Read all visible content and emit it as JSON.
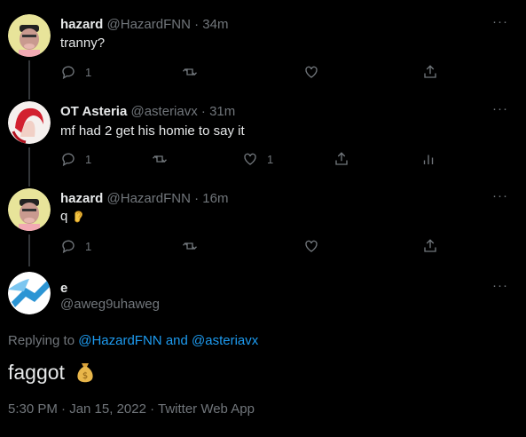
{
  "replies": [
    {
      "name": "hazard",
      "handle": "@HazardFNN",
      "time": "· 34m",
      "text": "tranny?",
      "actions": {
        "reply_count": "1",
        "retweet_count": "",
        "like_count": ""
      }
    },
    {
      "name": "OT Asteria",
      "handle": "@asteriavx",
      "time": "· 31m",
      "text": "mf had 2 get his homie to say it",
      "actions": {
        "reply_count": "1",
        "retweet_count": "",
        "like_count": "1"
      }
    },
    {
      "name": "hazard",
      "handle": "@HazardFNN",
      "time": "· 16m",
      "text": "q",
      "actions": {
        "reply_count": "1",
        "retweet_count": "",
        "like_count": ""
      }
    }
  ],
  "main_tweet": {
    "name": "e",
    "handle": "@aweg9uhaweg",
    "replying_prefix": "Replying to",
    "replying_to_1": "@HazardFNN",
    "replying_and": "and",
    "replying_to_2": "@asteriavx",
    "text": "faggot",
    "timestamp": "5:30 PM · Jan 15, 2022 · Twitter Web App"
  },
  "more_label": "···",
  "colors": {
    "background": "#000000",
    "text": "#e7e9ea",
    "muted": "#71767b",
    "link": "#1d9bf0",
    "rail": "#333639"
  }
}
